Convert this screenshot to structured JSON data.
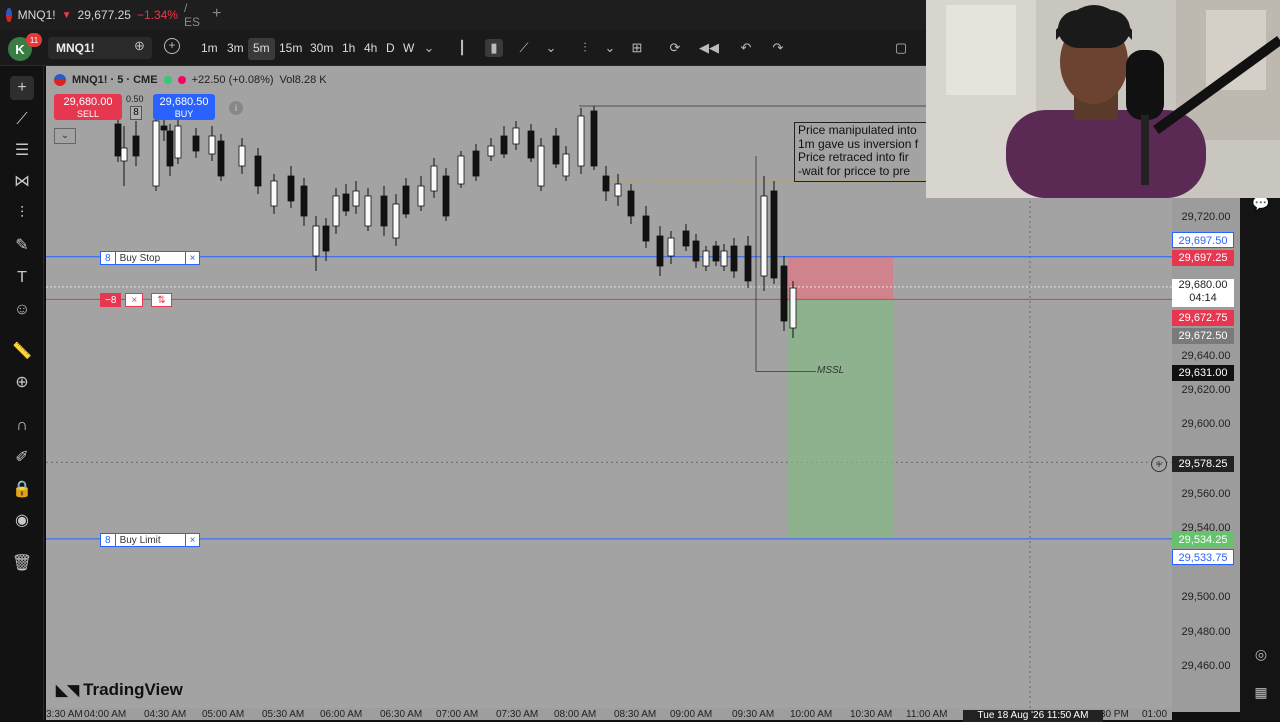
{
  "browser_tab": {
    "symbol": "MNQ1!",
    "price": "29,677.25",
    "change": "−1.34%",
    "suffix": "/ ES"
  },
  "toolbar": {
    "avatar_letter": "K",
    "notifications": "11",
    "symbol": "MNQ1!",
    "timeframes": [
      "1m",
      "3m",
      "5m",
      "15m",
      "30m",
      "1h",
      "4h",
      "D",
      "W"
    ],
    "active_timeframe": "5m"
  },
  "legend": {
    "symbol": "MNQ1! · 5 · CME",
    "change": "+22.50 (+0.08%)",
    "volume": "Vol8.28 K"
  },
  "trade": {
    "sell_price": "29,680.00",
    "sell_label": "SELL",
    "buy_price": "29,680.50",
    "buy_label": "BUY",
    "spread": "0.50",
    "qty": "8"
  },
  "orders": {
    "buy_stop": {
      "qty": "8",
      "label": "Buy Stop",
      "close": "×"
    },
    "buy_limit": {
      "qty": "8",
      "label": "Buy Limit",
      "close": "×"
    },
    "position": {
      "qty": "−8",
      "close": "×",
      "reverse": "⇅"
    }
  },
  "note_lines": [
    "Price manipulated into",
    "1m gave us inversion f",
    "Price retraced into fir",
    "-wait for pricce to pre"
  ],
  "mssl_label": "MSSL",
  "brand": "TradingView",
  "price_scale": {
    "labels": [
      "29,720.00",
      "29,640.00",
      "29,620.00",
      "29,600.00",
      "29,560.00",
      "29,540.00",
      "29,500.00",
      "29,480.00",
      "29,460.00"
    ],
    "boxes": {
      "buy_stop_blue": "29,697.50",
      "buy_stop_red": "29,697.25",
      "current": "29,680.00",
      "countdown": "04:14",
      "position_red": "29,672.75",
      "position_grey": "29,672.50",
      "mssl": "29,631.00",
      "crosshair": "29,578.25",
      "limit_green": "29,534.25",
      "limit_blue": "29,533.75"
    }
  },
  "time_axis": {
    "labels": [
      "3:30 AM",
      "04:00 AM",
      "04:30 AM",
      "05:00 AM",
      "05:30 AM",
      "06:00 AM",
      "06:30 AM",
      "07:00 AM",
      "07:30 AM",
      "08:00 AM",
      "08:30 AM",
      "09:00 AM",
      "09:30 AM",
      "10:00 AM",
      "10:30 AM",
      "11:00 AM",
      "12:30 PM",
      "01:00"
    ],
    "crosshair": "Tue 18 Aug '26   11:50 AM"
  },
  "colors": {
    "chart_bg": "#a3a3a3",
    "buy_blue": "#2962ff",
    "sell_red": "#e53750",
    "target_green": "#84b884",
    "stop_red": "#d97b86"
  },
  "chart_data": {
    "type": "candlestick",
    "symbol": "MNQ1!",
    "interval": "5",
    "ylim": [
      29450,
      29740
    ],
    "y_ticks": [
      29720,
      29640,
      29620,
      29600,
      29560,
      29540,
      29500,
      29480,
      29460
    ],
    "current_price": 29680.0,
    "long_position": {
      "entry": 29672.75,
      "stop": 29697.25,
      "target": 29534.25
    },
    "buy_stop": 29697.5,
    "buy_limit": 29533.75,
    "mssl": 29631.0
  }
}
